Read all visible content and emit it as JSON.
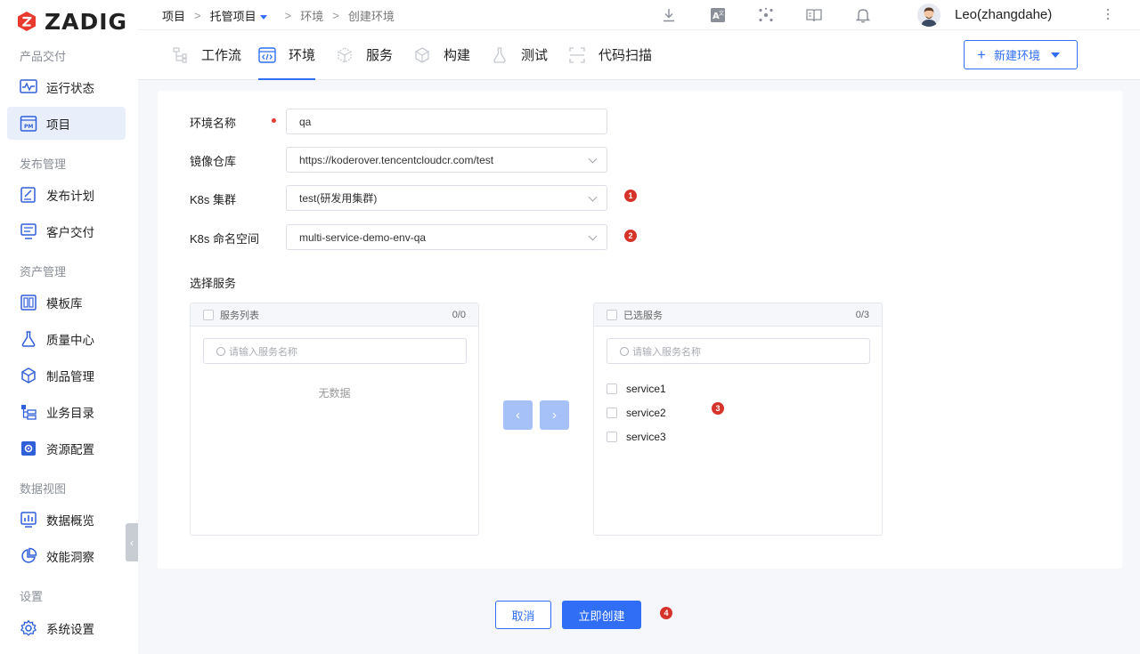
{
  "brand": {
    "name": "ZADIG",
    "color": "#e8392f"
  },
  "sidebar": {
    "sections": [
      {
        "title": "产品交付",
        "items": [
          {
            "label": "运行状态",
            "icon": "monitor-pulse-icon"
          },
          {
            "label": "项目",
            "icon": "project-pm-icon",
            "active": true
          }
        ]
      },
      {
        "title": "发布管理",
        "items": [
          {
            "label": "发布计划",
            "icon": "plan-icon"
          },
          {
            "label": "客户交付",
            "icon": "delivery-icon"
          }
        ]
      },
      {
        "title": "资产管理",
        "items": [
          {
            "label": "模板库",
            "icon": "template-icon"
          },
          {
            "label": "质量中心",
            "icon": "flask-icon"
          },
          {
            "label": "制品管理",
            "icon": "artifact-icon"
          },
          {
            "label": "业务目录",
            "icon": "catalog-icon"
          },
          {
            "label": "资源配置",
            "icon": "gear-box-icon"
          }
        ]
      },
      {
        "title": "数据视图",
        "items": [
          {
            "label": "数据概览",
            "icon": "bar-chart-icon"
          },
          {
            "label": "效能洞察",
            "icon": "pie-chart-icon"
          }
        ]
      },
      {
        "title": "设置",
        "items": [
          {
            "label": "系统设置",
            "icon": "gear-icon"
          }
        ]
      }
    ]
  },
  "breadcrumb": {
    "root": "项目",
    "project": "托管项目",
    "env": "环境",
    "current": "创建环境"
  },
  "user": {
    "name": "Leo(zhangdahe)"
  },
  "tabs": [
    {
      "label": "工作流",
      "icon": "workflow-icon"
    },
    {
      "label": "环境",
      "icon": "code-env-icon",
      "active": true
    },
    {
      "label": "服务",
      "icon": "service-cube-icon"
    },
    {
      "label": "构建",
      "icon": "build-box-icon"
    },
    {
      "label": "测试",
      "icon": "test-flask-icon"
    },
    {
      "label": "代码扫描",
      "icon": "scan-icon"
    }
  ],
  "actions": {
    "new_env": "新建环境"
  },
  "form": {
    "env_name_label": "环境名称",
    "env_name_value": "qa",
    "registry_label": "镜像仓库",
    "registry_value": "https://koderover.tencentcloudcr.com/test",
    "cluster_label": "K8s 集群",
    "cluster_value": "test(研发用集群)",
    "namespace_label": "K8s 命名空间",
    "namespace_value": "multi-service-demo-env-qa",
    "select_services_label": "选择服务"
  },
  "transfer": {
    "left": {
      "title": "服务列表",
      "count": "0/0",
      "placeholder": "请输入服务名称",
      "empty": "无数据"
    },
    "right": {
      "title": "已选服务",
      "count": "0/3",
      "placeholder": "请输入服务名称",
      "items": [
        "service1",
        "service2",
        "service3"
      ]
    },
    "move_left": "‹",
    "move_right": "›"
  },
  "footer": {
    "cancel": "取消",
    "create": "立即创建"
  },
  "badges": [
    "1",
    "2",
    "3",
    "4"
  ]
}
